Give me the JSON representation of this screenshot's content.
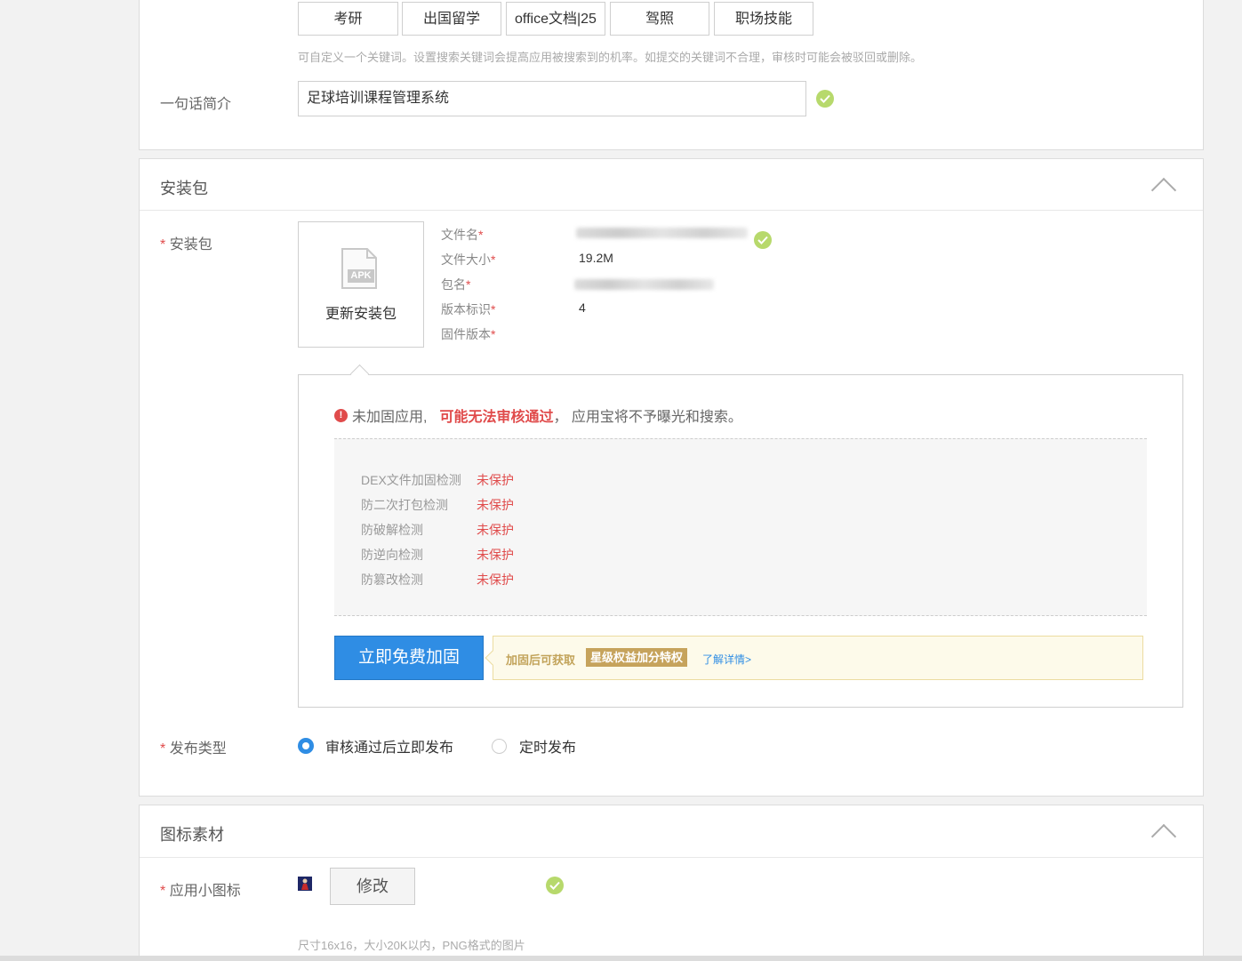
{
  "keywords": {
    "tags": [
      "考研",
      "出国留学",
      "office文档|25",
      "驾照",
      "职场技能"
    ],
    "hint": "可自定义一个关键词。设置搜索关键词会提高应用被搜索到的机率。如提交的关键词不合理，审核时可能会被驳回或删除。"
  },
  "intro": {
    "label": "一句话简介",
    "value": "足球培训课程管理系统"
  },
  "package_section": {
    "title": "安装包",
    "field_label": "安装包",
    "required_mark": "*",
    "apk_badge": "APK",
    "update_button": "更新安装包",
    "info": {
      "file_name_label": "文件名",
      "file_size_label": "文件大小",
      "file_size_value": "19.2M",
      "package_name_label": "包名",
      "version_label": "版本标识",
      "version_value": "4",
      "firmware_label": "固件版本"
    },
    "warning": {
      "prefix": "未加固应用,",
      "emphasis": "可能无法审核通过",
      "suffix": "，  应用宝将不予曝光和搜索。"
    },
    "checks": [
      {
        "name": "DEX文件加固检测",
        "status": "未保护"
      },
      {
        "name": "防二次打包检测",
        "status": "未保护"
      },
      {
        "name": "防破解检测",
        "status": "未保护"
      },
      {
        "name": "防逆向检测",
        "status": "未保护"
      },
      {
        "name": "防篡改检测",
        "status": "未保护"
      }
    ],
    "harden_button": "立即免费加固",
    "promo": {
      "text": "加固后可获取",
      "badge": "星级权益加分特权",
      "link": "了解详情>"
    },
    "publish": {
      "label": "发布类型",
      "option_now": "审核通过后立即发布",
      "option_scheduled": "定时发布",
      "selected": "option_now"
    }
  },
  "icon_section": {
    "title": "图标素材",
    "field_label": "应用小图标",
    "modify_button": "修改",
    "hint": "尺寸16x16，大小20K以内，PNG格式的图片"
  },
  "colors": {
    "accent_blue": "#2f8de4",
    "error_red": "#e04b4b",
    "success_green": "#b7d96c"
  }
}
